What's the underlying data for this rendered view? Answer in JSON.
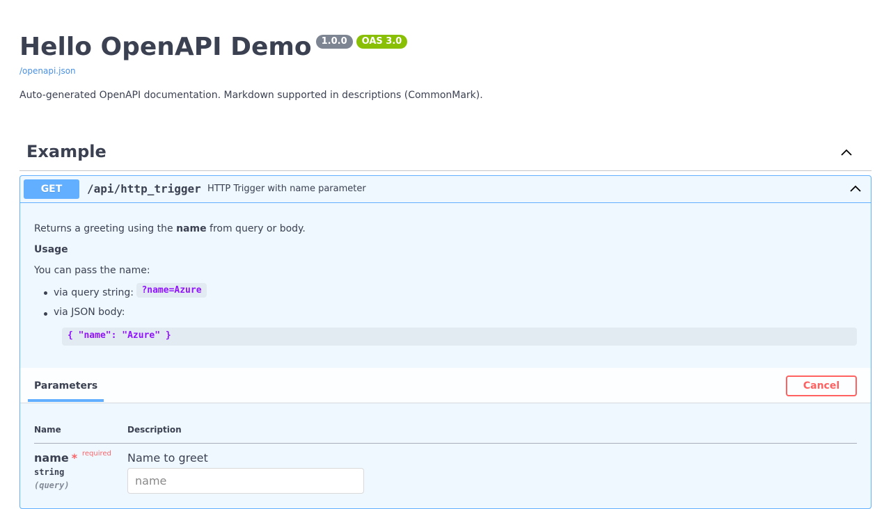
{
  "info": {
    "title": "Hello OpenAPI Demo",
    "version": "1.0.0",
    "oas_badge": "OAS 3.0",
    "spec_link": "/openapi.json",
    "description": "Auto-generated OpenAPI documentation. Markdown supported in descriptions (CommonMark)."
  },
  "tag": {
    "name": "Example",
    "collapse_icon": "chevron-up-icon"
  },
  "operation": {
    "method": "GET",
    "path": "/api/http_trigger",
    "summary": "HTTP Trigger with name parameter",
    "collapse_icon": "chevron-up-icon",
    "body": {
      "line1_prefix": "Returns a greeting using the ",
      "line1_bold": "name",
      "line1_suffix": " from query or body.",
      "usage_heading": "Usage",
      "pass_text": "You can pass the name:",
      "bullet1_text": "via query string: ",
      "bullet1_code": "?name=Azure",
      "bullet2_text": "via JSON body:",
      "code_block": "{ \"name\": \"Azure\" }"
    }
  },
  "parameters": {
    "tab_label": "Parameters",
    "cancel_label": "Cancel",
    "col_name": "Name",
    "col_description": "Description",
    "items": [
      {
        "name": "name",
        "required_star": "*",
        "required_label": "required",
        "type": "string",
        "in": "(query)",
        "description": "Name to greet",
        "placeholder": "name"
      }
    ]
  },
  "colors": {
    "get_method": "#61affe",
    "cancel": "#ff6060",
    "code": "#9012fe",
    "oas_badge": "#89bf04",
    "version_badge": "#7d8492"
  }
}
